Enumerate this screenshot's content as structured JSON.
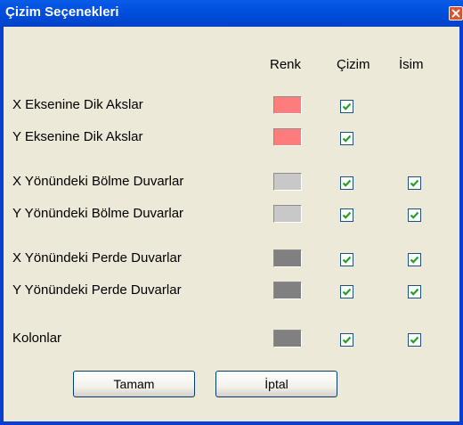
{
  "window": {
    "title": "Çizim Seçenekleri"
  },
  "columns": {
    "color": "Renk",
    "draw": "Çizim",
    "name": "İsim"
  },
  "rows": [
    {
      "label": "X Eksenine Dik Akslar",
      "color": "#ff7c7c",
      "draw": true,
      "name": null
    },
    {
      "label": "Y Eksenine Dik Akslar",
      "color": "#ff7c7c",
      "draw": true,
      "name": null
    },
    {
      "label": "X Yönündeki Bölme Duvarlar",
      "color": "#c8c8c8",
      "draw": true,
      "name": true
    },
    {
      "label": "Y Yönündeki Bölme Duvarlar",
      "color": "#c8c8c8",
      "draw": true,
      "name": true
    },
    {
      "label": "X Yönündeki Perde Duvarlar",
      "color": "#808080",
      "draw": true,
      "name": true
    },
    {
      "label": "Y Yönündeki Perde Duvarlar",
      "color": "#808080",
      "draw": true,
      "name": true
    },
    {
      "label": "Kolonlar",
      "color": "#808080",
      "draw": true,
      "name": true
    }
  ],
  "buttons": {
    "ok": "Tamam",
    "cancel": "İptal"
  }
}
